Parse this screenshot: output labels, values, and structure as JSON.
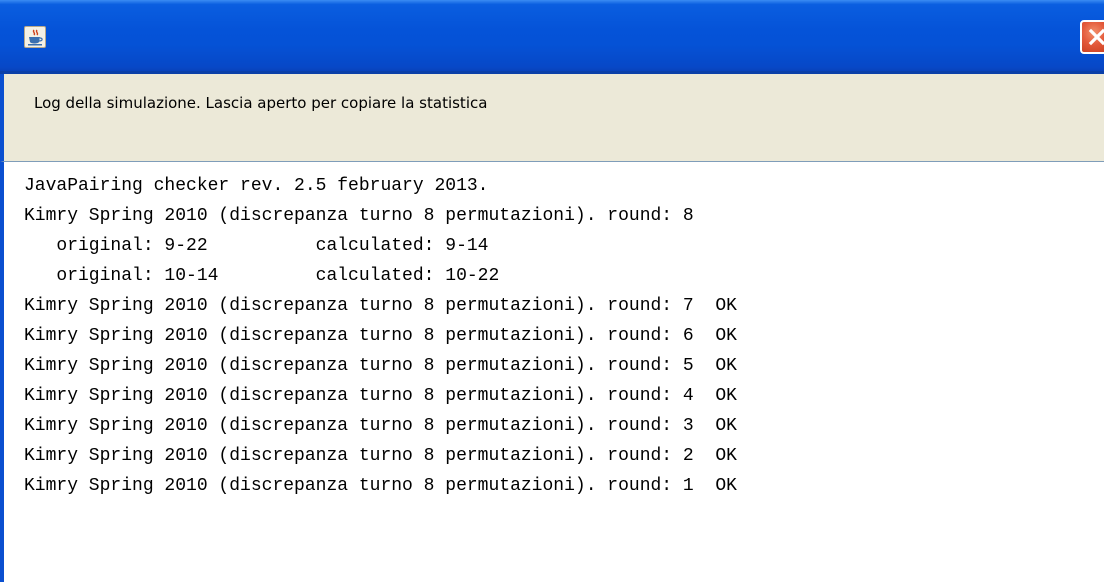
{
  "window": {
    "title": "",
    "app_icon": "java-cup-icon",
    "close_icon": "close-icon",
    "accent_color": "#0553d8",
    "close_color": "#e3593a"
  },
  "header": {
    "message": "Log della simulazione. Lascia aperto per copiare la statistica"
  },
  "log": {
    "lines": [
      "JavaPairing checker rev. 2.5 february 2013.",
      "Kimry Spring 2010 (discrepanza turno 8 permutazioni). round: 8",
      "   original: 9-22          calculated: 9-14",
      "   original: 10-14         calculated: 10-22",
      "Kimry Spring 2010 (discrepanza turno 8 permutazioni). round: 7  OK",
      "Kimry Spring 2010 (discrepanza turno 8 permutazioni). round: 6  OK",
      "Kimry Spring 2010 (discrepanza turno 8 permutazioni). round: 5  OK",
      "Kimry Spring 2010 (discrepanza turno 8 permutazioni). round: 4  OK",
      "Kimry Spring 2010 (discrepanza turno 8 permutazioni). round: 3  OK",
      "Kimry Spring 2010 (discrepanza turno 8 permutazioni). round: 2  OK",
      "Kimry Spring 2010 (discrepanza turno 8 permutazioni). round: 1  OK"
    ]
  }
}
